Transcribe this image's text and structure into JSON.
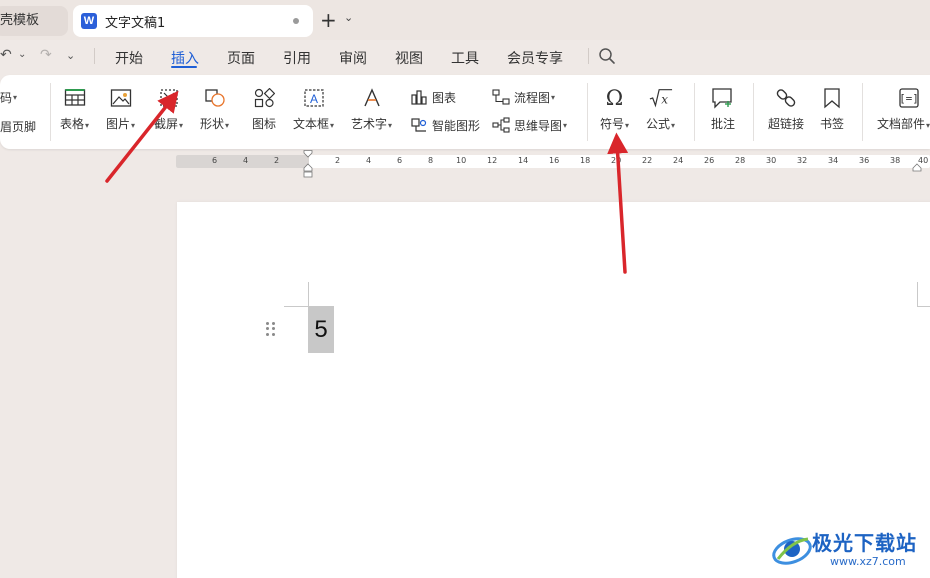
{
  "tabs": {
    "prev_tab_label": "壳模板",
    "active_tab_logo": "W",
    "active_tab_title": "文字文稿1",
    "new_tab": "+",
    "new_tab_menu": "⌄"
  },
  "quick_access": {
    "undo": "↶",
    "undo_menu": "⌄",
    "redo": "↷",
    "more": "⌄"
  },
  "menu": {
    "items": [
      "开始",
      "插入",
      "页面",
      "引用",
      "审阅",
      "视图",
      "工具",
      "会员专享"
    ],
    "active": "插入",
    "search_icon": "search-icon",
    "accent_color": "#1f5fd6"
  },
  "ribbon": {
    "partial_top": "码",
    "partial_bottom": "眉页脚",
    "table": "表格",
    "picture": "图片",
    "screenshot": "截屏",
    "shapes": "形状",
    "icons": "图标",
    "textbox": "文本框",
    "wordart": "艺术字",
    "chart": "图表",
    "smartart": "智能图形",
    "flowchart": "流程图",
    "mindmap": "思维导图",
    "symbol": "符号",
    "formula": "公式",
    "comment": "批注",
    "hyperlink": "超链接",
    "bookmark": "书签",
    "docparts": "文档部件"
  },
  "ruler": {
    "left_numbers": [
      "6",
      "4",
      "2"
    ],
    "right_numbers": [
      "2",
      "4",
      "6",
      "8",
      "10",
      "12",
      "14",
      "16",
      "18",
      "20",
      "22",
      "24",
      "26",
      "28",
      "30",
      "32",
      "34",
      "36",
      "38",
      "40"
    ]
  },
  "document": {
    "selected_text": "5"
  },
  "watermark": {
    "title": "极光下载站",
    "url": "www.xz7.com"
  },
  "colors": {
    "annotation_arrow": "#d9262b",
    "watermark_blue": "#1d63c3"
  }
}
